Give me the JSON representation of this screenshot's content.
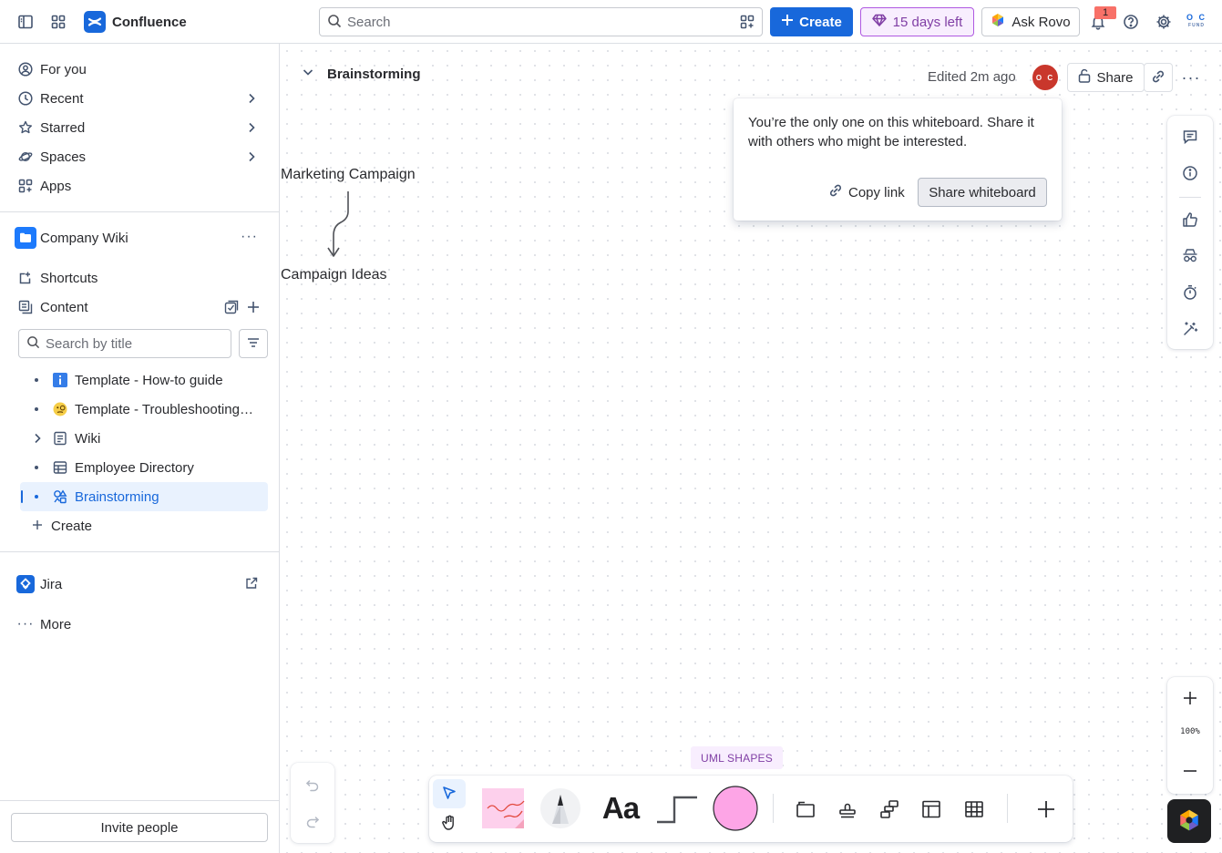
{
  "app": {
    "name": "Confluence"
  },
  "topbar": {
    "search_placeholder": "Search",
    "create_label": "Create",
    "trial_label": "15 days left",
    "rovo_label": "Ask Rovo",
    "notification_count": "1",
    "avatar_initials": "O C",
    "avatar_subtext": "FUND"
  },
  "sidebar": {
    "nav": [
      {
        "label": "For you"
      },
      {
        "label": "Recent"
      },
      {
        "label": "Starred"
      },
      {
        "label": "Spaces"
      },
      {
        "label": "Apps"
      }
    ],
    "space_name": "Company Wiki",
    "shortcuts_label": "Shortcuts",
    "content_label": "Content",
    "tree_search_placeholder": "Search by title",
    "tree": [
      {
        "label": "Template - How-to guide"
      },
      {
        "label": "Template - Troubleshooting article"
      },
      {
        "label": "Wiki"
      },
      {
        "label": "Employee Directory"
      },
      {
        "label": "Brainstorming"
      }
    ],
    "create_label": "Create",
    "jira_label": "Jira",
    "more_label": "More",
    "invite_label": "Invite people"
  },
  "whiteboard": {
    "title": "Brainstorming",
    "edited": "Edited 2m ago",
    "share_label": "Share",
    "collab_initials": "O C",
    "popover": {
      "message": "You’re the only one on this whiteboard. Share it with others who might be interested.",
      "copy_link": "Copy link",
      "share_whiteboard": "Share whiteboard"
    },
    "nodes": [
      {
        "text": "Marketing Campaign"
      },
      {
        "text": "Campaign Ideas"
      }
    ],
    "zoom": "100%",
    "uml_label": "UML SHAPES",
    "text_tool": "Aa"
  },
  "colors": {
    "brand": "#1868db",
    "sticky_note": "#fdd0ec",
    "shape_fill": "#fda5e6",
    "trial_accent": "#803fa5"
  }
}
